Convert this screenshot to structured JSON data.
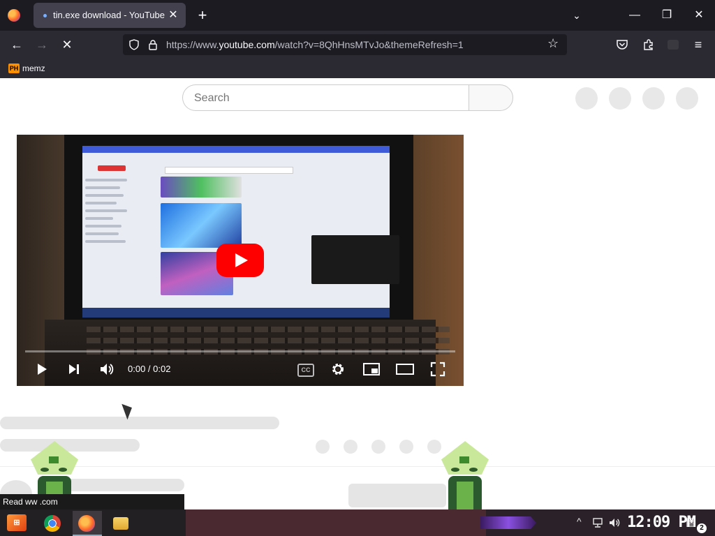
{
  "browser": {
    "tab_title": "tin.exe download - YouTube",
    "url_prefix": "https://www.",
    "url_domain": "youtube.com",
    "url_path": "/watch?v=8QhHnsMTvJo&themeRefresh=1",
    "bookmark_label": "memz",
    "bookmark_icon_text": "PH",
    "new_tab": "+",
    "close_tab": "✕",
    "tab_list": "⌄",
    "minimize": "—",
    "restore": "❐",
    "close_window": "✕",
    "back": "←",
    "forward": "→",
    "stop": "✕",
    "star": "☆",
    "menu": "≡"
  },
  "page": {
    "search_placeholder": "Search"
  },
  "player": {
    "time": "0:00 / 0:02",
    "cc_label": "CC"
  },
  "tooltip": {
    "text": "Read ww          .com"
  },
  "taskbar": {
    "clock": "12:09 PM",
    "notification_count": "2"
  },
  "colors": {
    "play_button": "#ff0000",
    "tab_bg": "#42414d",
    "toolbar_bg": "#2b2a33"
  }
}
